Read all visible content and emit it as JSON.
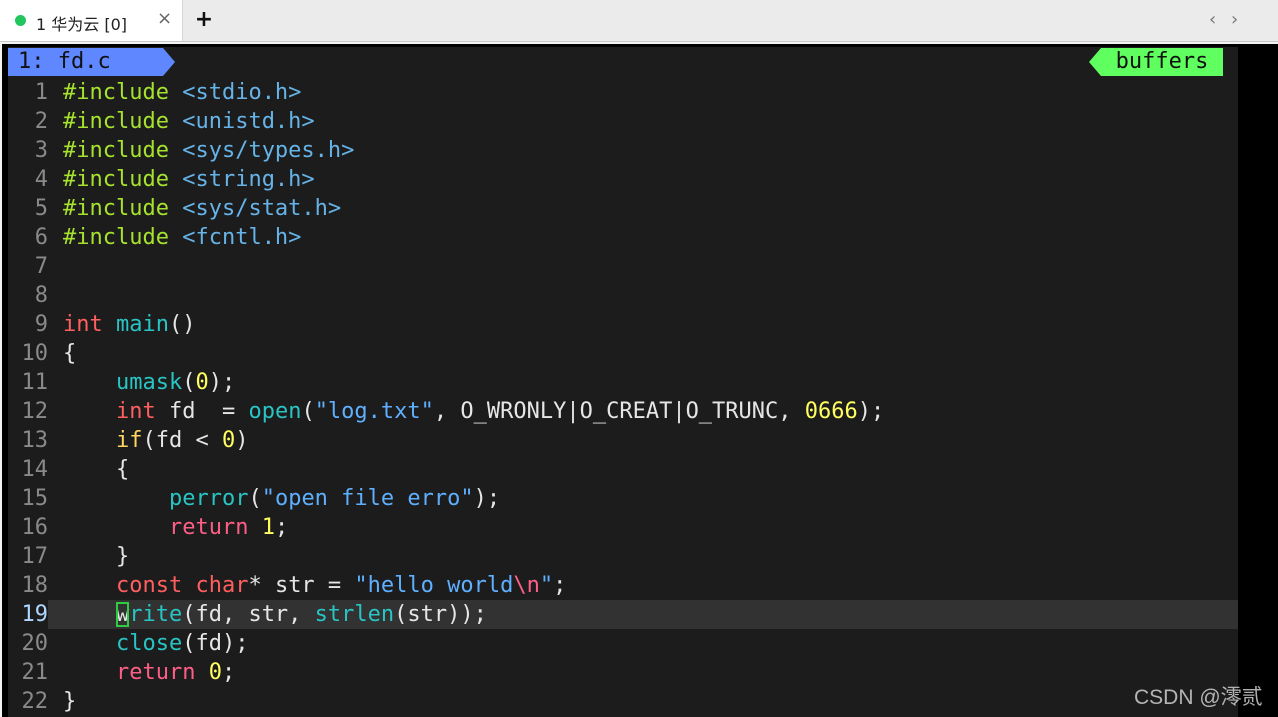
{
  "window": {
    "tab": {
      "status_color": "#22c55e",
      "title": "1 华为云 [0]",
      "close_icon": "×"
    },
    "new_tab_label": "+",
    "nav": {
      "prev": "‹",
      "next": "›"
    }
  },
  "vim": {
    "tabline": {
      "active_buffer": "1: fd.c",
      "right_label": "buffers"
    },
    "cursor_line": 19,
    "lines": [
      {
        "n": "1",
        "segments": [
          [
            "pp",
            "#include "
          ],
          [
            "hdr",
            "<stdio.h>"
          ]
        ]
      },
      {
        "n": "2",
        "segments": [
          [
            "pp",
            "#include "
          ],
          [
            "hdr",
            "<unistd.h>"
          ]
        ]
      },
      {
        "n": "3",
        "segments": [
          [
            "pp",
            "#include "
          ],
          [
            "hdr",
            "<sys/types.h>"
          ]
        ]
      },
      {
        "n": "4",
        "segments": [
          [
            "pp",
            "#include "
          ],
          [
            "hdr",
            "<string.h>"
          ]
        ]
      },
      {
        "n": "5",
        "segments": [
          [
            "pp",
            "#include "
          ],
          [
            "hdr",
            "<sys/stat.h>"
          ]
        ]
      },
      {
        "n": "6",
        "segments": [
          [
            "pp",
            "#include "
          ],
          [
            "hdr",
            "<fcntl.h>"
          ]
        ]
      },
      {
        "n": "7",
        "segments": []
      },
      {
        "n": "8",
        "segments": []
      },
      {
        "n": "9",
        "segments": [
          [
            "ty",
            "int"
          ],
          [
            "pu",
            " "
          ],
          [
            "fn",
            "main"
          ],
          [
            "pu",
            "()"
          ]
        ]
      },
      {
        "n": "10",
        "segments": [
          [
            "pu",
            "{"
          ]
        ]
      },
      {
        "n": "11",
        "segments": [
          [
            "pu",
            "    "
          ],
          [
            "fn",
            "umask"
          ],
          [
            "pu",
            "("
          ],
          [
            "num",
            "0"
          ],
          [
            "pu",
            ");"
          ]
        ]
      },
      {
        "n": "12",
        "segments": [
          [
            "pu",
            "    "
          ],
          [
            "ty",
            "int"
          ],
          [
            "pu",
            " fd  = "
          ],
          [
            "fn",
            "open"
          ],
          [
            "pu",
            "("
          ],
          [
            "str",
            "\"log.txt\""
          ],
          [
            "pu",
            ", O_WRONLY|O_CREAT|O_TRUNC, "
          ],
          [
            "num",
            "0666"
          ],
          [
            "pu",
            ");"
          ]
        ]
      },
      {
        "n": "13",
        "segments": [
          [
            "pu",
            "    "
          ],
          [
            "kc",
            "if"
          ],
          [
            "pu",
            "(fd < "
          ],
          [
            "num",
            "0"
          ],
          [
            "pu",
            ")"
          ]
        ]
      },
      {
        "n": "14",
        "segments": [
          [
            "pu",
            "    {"
          ]
        ]
      },
      {
        "n": "15",
        "segments": [
          [
            "pu",
            "        "
          ],
          [
            "fn",
            "perror"
          ],
          [
            "pu",
            "("
          ],
          [
            "str",
            "\"open file erro\""
          ],
          [
            "pu",
            ");"
          ]
        ]
      },
      {
        "n": "16",
        "segments": [
          [
            "pu",
            "        "
          ],
          [
            "kw",
            "return"
          ],
          [
            "pu",
            " "
          ],
          [
            "num",
            "1"
          ],
          [
            "pu",
            ";"
          ]
        ]
      },
      {
        "n": "17",
        "segments": [
          [
            "pu",
            "    }"
          ]
        ]
      },
      {
        "n": "18",
        "segments": [
          [
            "pu",
            "    "
          ],
          [
            "ty",
            "const"
          ],
          [
            "pu",
            " "
          ],
          [
            "ty",
            "char"
          ],
          [
            "pu",
            "* str = "
          ],
          [
            "str",
            "\"hello world"
          ],
          [
            "esc",
            "\\n"
          ],
          [
            "str",
            "\""
          ],
          [
            "pu",
            ";"
          ]
        ]
      },
      {
        "n": "19",
        "segments": [
          [
            "pu",
            "    "
          ],
          [
            "cursor",
            "w"
          ],
          [
            "fn",
            "rite"
          ],
          [
            "pu",
            "(fd, str, "
          ],
          [
            "fn",
            "strlen"
          ],
          [
            "pu",
            "(str));"
          ]
        ]
      },
      {
        "n": "20",
        "segments": [
          [
            "pu",
            "    "
          ],
          [
            "fn",
            "close"
          ],
          [
            "pu",
            "(fd);"
          ]
        ]
      },
      {
        "n": "21",
        "segments": [
          [
            "pu",
            "    "
          ],
          [
            "kw",
            "return"
          ],
          [
            "pu",
            " "
          ],
          [
            "num",
            "0"
          ],
          [
            "pu",
            ";"
          ]
        ]
      },
      {
        "n": "22",
        "segments": [
          [
            "pu",
            "}"
          ]
        ]
      }
    ]
  },
  "watermark": "CSDN @澪贰"
}
